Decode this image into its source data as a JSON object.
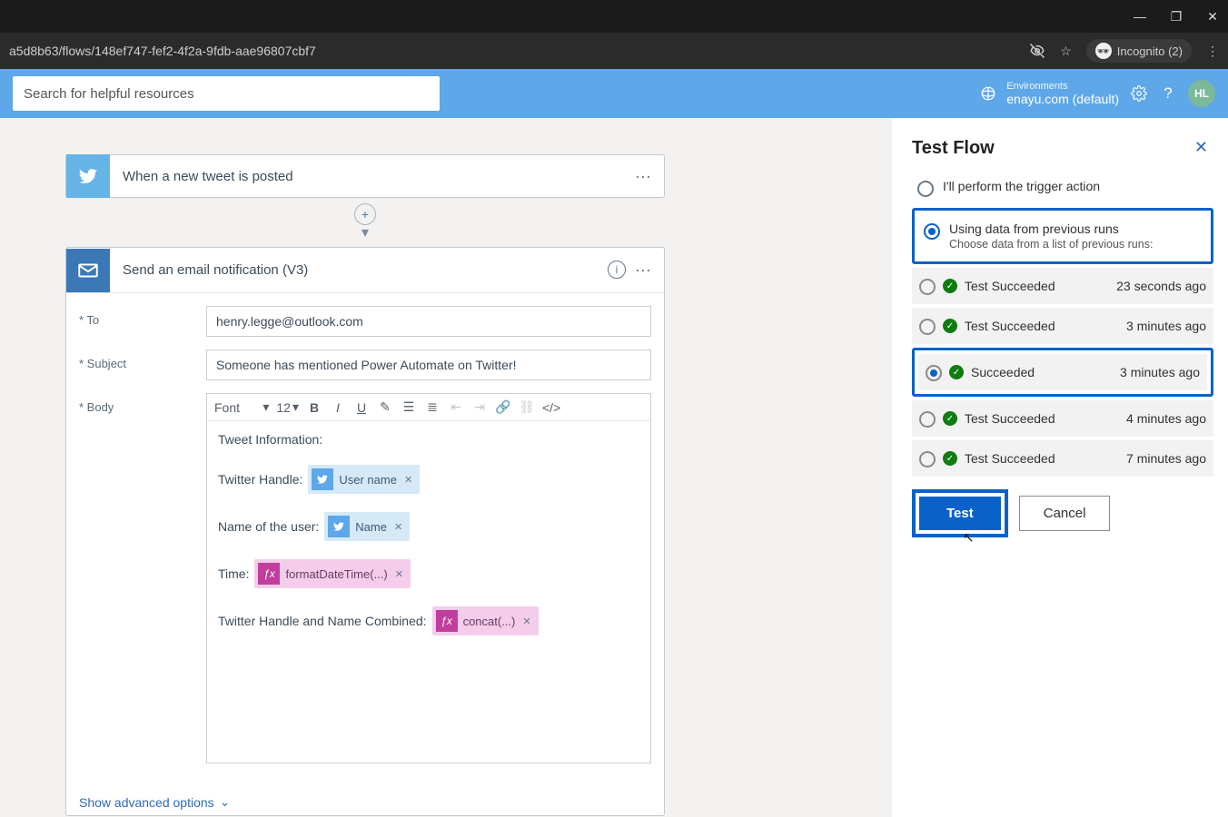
{
  "browser": {
    "url": "a5d8b63/flows/148ef747-fef2-4f2a-9fdb-aae96807cbf7",
    "incognito_label": "Incognito (2)"
  },
  "header": {
    "search_placeholder": "Search for helpful resources",
    "env_label": "Environments",
    "env_value": "enayu.com (default)",
    "avatar": "HL"
  },
  "flow": {
    "trigger_title": "When a new tweet is posted",
    "action_title": "Send an email notification (V3)",
    "fields": {
      "to_label": "* To",
      "to_value": "henry.legge@outlook.com",
      "subject_label": "* Subject",
      "subject_value": "Someone has mentioned Power Automate on Twitter!",
      "body_label": "* Body"
    },
    "rte": {
      "font_label": "Font",
      "size_label": "12"
    },
    "body_lines": {
      "l0": "Tweet Information:",
      "l1_prefix": "Twitter Handle:",
      "l1_token": "User name",
      "l2_prefix": "Name of the user:",
      "l2_token": "Name",
      "l3_prefix": "Time:",
      "l3_token": "formatDateTime(...)",
      "l4_prefix": "Twitter Handle and Name Combined:",
      "l4_token": "concat(...)"
    },
    "advanced": "Show advanced options"
  },
  "panel": {
    "title": "Test Flow",
    "opt1": "I'll perform the trigger action",
    "opt2": "Using data from previous runs",
    "opt2_sub": "Choose data from a list of previous runs:",
    "runs": [
      {
        "name": "Test Succeeded",
        "time": "23 seconds ago",
        "selected": false
      },
      {
        "name": "Test Succeeded",
        "time": "3 minutes ago",
        "selected": false
      },
      {
        "name": "Succeeded",
        "time": "3 minutes ago",
        "selected": true
      },
      {
        "name": "Test Succeeded",
        "time": "4 minutes ago",
        "selected": false
      },
      {
        "name": "Test Succeeded",
        "time": "7 minutes ago",
        "selected": false
      }
    ],
    "test_btn": "Test",
    "cancel_btn": "Cancel"
  }
}
